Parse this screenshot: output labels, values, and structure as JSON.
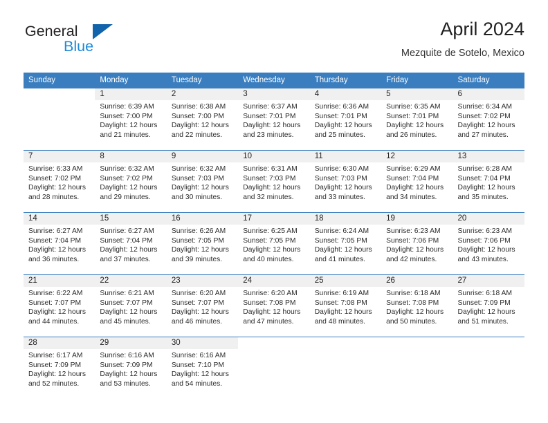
{
  "brand": {
    "name_part1": "General",
    "name_part2": "Blue",
    "triangle_color": "#1163ab",
    "blue_text_color": "#1c8ada"
  },
  "header": {
    "title": "April 2024",
    "subtitle": "Mezquite de Sotelo, Mexico"
  },
  "theme": {
    "header_bg": "#3a7ebf",
    "daynum_band_bg": "#f0f0f0",
    "divider": "#3a7ebf"
  },
  "weekday_headers": [
    "Sunday",
    "Monday",
    "Tuesday",
    "Wednesday",
    "Thursday",
    "Friday",
    "Saturday"
  ],
  "weeks": [
    [
      {
        "day": "",
        "sunrise": "",
        "sunset": "",
        "daylight1": "",
        "daylight2": ""
      },
      {
        "day": "1",
        "sunrise": "Sunrise: 6:39 AM",
        "sunset": "Sunset: 7:00 PM",
        "daylight1": "Daylight: 12 hours",
        "daylight2": "and 21 minutes."
      },
      {
        "day": "2",
        "sunrise": "Sunrise: 6:38 AM",
        "sunset": "Sunset: 7:00 PM",
        "daylight1": "Daylight: 12 hours",
        "daylight2": "and 22 minutes."
      },
      {
        "day": "3",
        "sunrise": "Sunrise: 6:37 AM",
        "sunset": "Sunset: 7:01 PM",
        "daylight1": "Daylight: 12 hours",
        "daylight2": "and 23 minutes."
      },
      {
        "day": "4",
        "sunrise": "Sunrise: 6:36 AM",
        "sunset": "Sunset: 7:01 PM",
        "daylight1": "Daylight: 12 hours",
        "daylight2": "and 25 minutes."
      },
      {
        "day": "5",
        "sunrise": "Sunrise: 6:35 AM",
        "sunset": "Sunset: 7:01 PM",
        "daylight1": "Daylight: 12 hours",
        "daylight2": "and 26 minutes."
      },
      {
        "day": "6",
        "sunrise": "Sunrise: 6:34 AM",
        "sunset": "Sunset: 7:02 PM",
        "daylight1": "Daylight: 12 hours",
        "daylight2": "and 27 minutes."
      }
    ],
    [
      {
        "day": "7",
        "sunrise": "Sunrise: 6:33 AM",
        "sunset": "Sunset: 7:02 PM",
        "daylight1": "Daylight: 12 hours",
        "daylight2": "and 28 minutes."
      },
      {
        "day": "8",
        "sunrise": "Sunrise: 6:32 AM",
        "sunset": "Sunset: 7:02 PM",
        "daylight1": "Daylight: 12 hours",
        "daylight2": "and 29 minutes."
      },
      {
        "day": "9",
        "sunrise": "Sunrise: 6:32 AM",
        "sunset": "Sunset: 7:03 PM",
        "daylight1": "Daylight: 12 hours",
        "daylight2": "and 30 minutes."
      },
      {
        "day": "10",
        "sunrise": "Sunrise: 6:31 AM",
        "sunset": "Sunset: 7:03 PM",
        "daylight1": "Daylight: 12 hours",
        "daylight2": "and 32 minutes."
      },
      {
        "day": "11",
        "sunrise": "Sunrise: 6:30 AM",
        "sunset": "Sunset: 7:03 PM",
        "daylight1": "Daylight: 12 hours",
        "daylight2": "and 33 minutes."
      },
      {
        "day": "12",
        "sunrise": "Sunrise: 6:29 AM",
        "sunset": "Sunset: 7:04 PM",
        "daylight1": "Daylight: 12 hours",
        "daylight2": "and 34 minutes."
      },
      {
        "day": "13",
        "sunrise": "Sunrise: 6:28 AM",
        "sunset": "Sunset: 7:04 PM",
        "daylight1": "Daylight: 12 hours",
        "daylight2": "and 35 minutes."
      }
    ],
    [
      {
        "day": "14",
        "sunrise": "Sunrise: 6:27 AM",
        "sunset": "Sunset: 7:04 PM",
        "daylight1": "Daylight: 12 hours",
        "daylight2": "and 36 minutes."
      },
      {
        "day": "15",
        "sunrise": "Sunrise: 6:27 AM",
        "sunset": "Sunset: 7:04 PM",
        "daylight1": "Daylight: 12 hours",
        "daylight2": "and 37 minutes."
      },
      {
        "day": "16",
        "sunrise": "Sunrise: 6:26 AM",
        "sunset": "Sunset: 7:05 PM",
        "daylight1": "Daylight: 12 hours",
        "daylight2": "and 39 minutes."
      },
      {
        "day": "17",
        "sunrise": "Sunrise: 6:25 AM",
        "sunset": "Sunset: 7:05 PM",
        "daylight1": "Daylight: 12 hours",
        "daylight2": "and 40 minutes."
      },
      {
        "day": "18",
        "sunrise": "Sunrise: 6:24 AM",
        "sunset": "Sunset: 7:05 PM",
        "daylight1": "Daylight: 12 hours",
        "daylight2": "and 41 minutes."
      },
      {
        "day": "19",
        "sunrise": "Sunrise: 6:23 AM",
        "sunset": "Sunset: 7:06 PM",
        "daylight1": "Daylight: 12 hours",
        "daylight2": "and 42 minutes."
      },
      {
        "day": "20",
        "sunrise": "Sunrise: 6:23 AM",
        "sunset": "Sunset: 7:06 PM",
        "daylight1": "Daylight: 12 hours",
        "daylight2": "and 43 minutes."
      }
    ],
    [
      {
        "day": "21",
        "sunrise": "Sunrise: 6:22 AM",
        "sunset": "Sunset: 7:07 PM",
        "daylight1": "Daylight: 12 hours",
        "daylight2": "and 44 minutes."
      },
      {
        "day": "22",
        "sunrise": "Sunrise: 6:21 AM",
        "sunset": "Sunset: 7:07 PM",
        "daylight1": "Daylight: 12 hours",
        "daylight2": "and 45 minutes."
      },
      {
        "day": "23",
        "sunrise": "Sunrise: 6:20 AM",
        "sunset": "Sunset: 7:07 PM",
        "daylight1": "Daylight: 12 hours",
        "daylight2": "and 46 minutes."
      },
      {
        "day": "24",
        "sunrise": "Sunrise: 6:20 AM",
        "sunset": "Sunset: 7:08 PM",
        "daylight1": "Daylight: 12 hours",
        "daylight2": "and 47 minutes."
      },
      {
        "day": "25",
        "sunrise": "Sunrise: 6:19 AM",
        "sunset": "Sunset: 7:08 PM",
        "daylight1": "Daylight: 12 hours",
        "daylight2": "and 48 minutes."
      },
      {
        "day": "26",
        "sunrise": "Sunrise: 6:18 AM",
        "sunset": "Sunset: 7:08 PM",
        "daylight1": "Daylight: 12 hours",
        "daylight2": "and 50 minutes."
      },
      {
        "day": "27",
        "sunrise": "Sunrise: 6:18 AM",
        "sunset": "Sunset: 7:09 PM",
        "daylight1": "Daylight: 12 hours",
        "daylight2": "and 51 minutes."
      }
    ],
    [
      {
        "day": "28",
        "sunrise": "Sunrise: 6:17 AM",
        "sunset": "Sunset: 7:09 PM",
        "daylight1": "Daylight: 12 hours",
        "daylight2": "and 52 minutes."
      },
      {
        "day": "29",
        "sunrise": "Sunrise: 6:16 AM",
        "sunset": "Sunset: 7:09 PM",
        "daylight1": "Daylight: 12 hours",
        "daylight2": "and 53 minutes."
      },
      {
        "day": "30",
        "sunrise": "Sunrise: 6:16 AM",
        "sunset": "Sunset: 7:10 PM",
        "daylight1": "Daylight: 12 hours",
        "daylight2": "and 54 minutes."
      },
      {
        "day": "",
        "sunrise": "",
        "sunset": "",
        "daylight1": "",
        "daylight2": ""
      },
      {
        "day": "",
        "sunrise": "",
        "sunset": "",
        "daylight1": "",
        "daylight2": ""
      },
      {
        "day": "",
        "sunrise": "",
        "sunset": "",
        "daylight1": "",
        "daylight2": ""
      },
      {
        "day": "",
        "sunrise": "",
        "sunset": "",
        "daylight1": "",
        "daylight2": ""
      }
    ]
  ]
}
